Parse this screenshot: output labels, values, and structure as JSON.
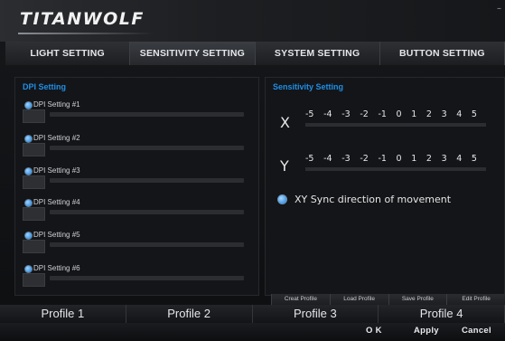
{
  "header": {
    "logo_text": "TITANWOLF",
    "minimize_label": "–"
  },
  "tabs": [
    {
      "label": "LIGHT SETTING"
    },
    {
      "label": "SENSITIVITY SETTING"
    },
    {
      "label": "SYSTEM SETTING"
    },
    {
      "label": "BUTTON SETTING"
    }
  ],
  "dpi_panel": {
    "title": "DPI Setting",
    "rows": [
      {
        "label": "DPI Setting #1"
      },
      {
        "label": "DPI Setting #2"
      },
      {
        "label": "DPI Setting #3"
      },
      {
        "label": "DPI Setting #4"
      },
      {
        "label": "DPI Setting #5"
      },
      {
        "label": "DPI Setting #6"
      }
    ]
  },
  "sensitivity_panel": {
    "title": "Sensitivity Setting",
    "x_label": "X",
    "y_label": "Y",
    "scale": [
      "-5",
      "-4",
      "-3",
      "-2",
      "-1",
      "0",
      "1",
      "2",
      "3",
      "4",
      "5"
    ],
    "sync_label": "XY Sync direction of movement"
  },
  "profile_actions": [
    {
      "label": "Creat Profile"
    },
    {
      "label": "Load Profile"
    },
    {
      "label": "Save Profile"
    },
    {
      "label": "Edit Profile"
    }
  ],
  "profiles": [
    {
      "label": "Profile 1"
    },
    {
      "label": "Profile 2"
    },
    {
      "label": "Profile 3"
    },
    {
      "label": "Profile 4"
    }
  ],
  "bottom_bar": {
    "ok": "O K",
    "apply": "Apply",
    "cancel": "Cancel"
  },
  "colors": {
    "accent": "#1e8fe6",
    "background": "#0e0f11"
  }
}
